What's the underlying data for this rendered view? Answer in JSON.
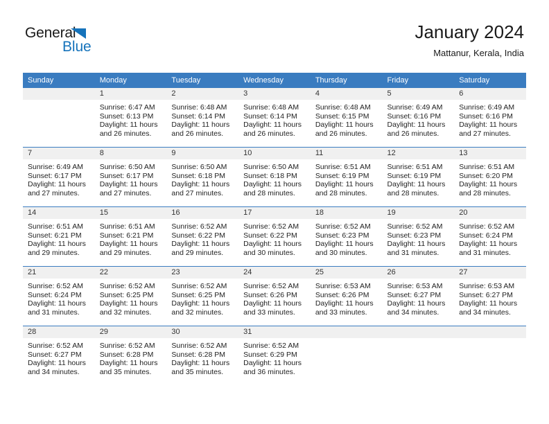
{
  "brand": {
    "name_part1": "General",
    "name_part2": "Blue",
    "triangle_color": "#1573bb"
  },
  "header": {
    "title": "January 2024",
    "subtitle": "Mattanur, Kerala, India",
    "header_bg_color": "#3a7cc0"
  },
  "weekday_headers": [
    "Sunday",
    "Monday",
    "Tuesday",
    "Wednesday",
    "Thursday",
    "Friday",
    "Saturday"
  ],
  "weeks": [
    [
      {
        "day": "",
        "sunrise": "",
        "sunset": "",
        "daylight_line1": "",
        "daylight_line2": ""
      },
      {
        "day": "1",
        "sunrise": "Sunrise: 6:47 AM",
        "sunset": "Sunset: 6:13 PM",
        "daylight_line1": "Daylight: 11 hours",
        "daylight_line2": "and 26 minutes."
      },
      {
        "day": "2",
        "sunrise": "Sunrise: 6:48 AM",
        "sunset": "Sunset: 6:14 PM",
        "daylight_line1": "Daylight: 11 hours",
        "daylight_line2": "and 26 minutes."
      },
      {
        "day": "3",
        "sunrise": "Sunrise: 6:48 AM",
        "sunset": "Sunset: 6:14 PM",
        "daylight_line1": "Daylight: 11 hours",
        "daylight_line2": "and 26 minutes."
      },
      {
        "day": "4",
        "sunrise": "Sunrise: 6:48 AM",
        "sunset": "Sunset: 6:15 PM",
        "daylight_line1": "Daylight: 11 hours",
        "daylight_line2": "and 26 minutes."
      },
      {
        "day": "5",
        "sunrise": "Sunrise: 6:49 AM",
        "sunset": "Sunset: 6:16 PM",
        "daylight_line1": "Daylight: 11 hours",
        "daylight_line2": "and 26 minutes."
      },
      {
        "day": "6",
        "sunrise": "Sunrise: 6:49 AM",
        "sunset": "Sunset: 6:16 PM",
        "daylight_line1": "Daylight: 11 hours",
        "daylight_line2": "and 27 minutes."
      }
    ],
    [
      {
        "day": "7",
        "sunrise": "Sunrise: 6:49 AM",
        "sunset": "Sunset: 6:17 PM",
        "daylight_line1": "Daylight: 11 hours",
        "daylight_line2": "and 27 minutes."
      },
      {
        "day": "8",
        "sunrise": "Sunrise: 6:50 AM",
        "sunset": "Sunset: 6:17 PM",
        "daylight_line1": "Daylight: 11 hours",
        "daylight_line2": "and 27 minutes."
      },
      {
        "day": "9",
        "sunrise": "Sunrise: 6:50 AM",
        "sunset": "Sunset: 6:18 PM",
        "daylight_line1": "Daylight: 11 hours",
        "daylight_line2": "and 27 minutes."
      },
      {
        "day": "10",
        "sunrise": "Sunrise: 6:50 AM",
        "sunset": "Sunset: 6:18 PM",
        "daylight_line1": "Daylight: 11 hours",
        "daylight_line2": "and 28 minutes."
      },
      {
        "day": "11",
        "sunrise": "Sunrise: 6:51 AM",
        "sunset": "Sunset: 6:19 PM",
        "daylight_line1": "Daylight: 11 hours",
        "daylight_line2": "and 28 minutes."
      },
      {
        "day": "12",
        "sunrise": "Sunrise: 6:51 AM",
        "sunset": "Sunset: 6:19 PM",
        "daylight_line1": "Daylight: 11 hours",
        "daylight_line2": "and 28 minutes."
      },
      {
        "day": "13",
        "sunrise": "Sunrise: 6:51 AM",
        "sunset": "Sunset: 6:20 PM",
        "daylight_line1": "Daylight: 11 hours",
        "daylight_line2": "and 28 minutes."
      }
    ],
    [
      {
        "day": "14",
        "sunrise": "Sunrise: 6:51 AM",
        "sunset": "Sunset: 6:21 PM",
        "daylight_line1": "Daylight: 11 hours",
        "daylight_line2": "and 29 minutes."
      },
      {
        "day": "15",
        "sunrise": "Sunrise: 6:51 AM",
        "sunset": "Sunset: 6:21 PM",
        "daylight_line1": "Daylight: 11 hours",
        "daylight_line2": "and 29 minutes."
      },
      {
        "day": "16",
        "sunrise": "Sunrise: 6:52 AM",
        "sunset": "Sunset: 6:22 PM",
        "daylight_line1": "Daylight: 11 hours",
        "daylight_line2": "and 29 minutes."
      },
      {
        "day": "17",
        "sunrise": "Sunrise: 6:52 AM",
        "sunset": "Sunset: 6:22 PM",
        "daylight_line1": "Daylight: 11 hours",
        "daylight_line2": "and 30 minutes."
      },
      {
        "day": "18",
        "sunrise": "Sunrise: 6:52 AM",
        "sunset": "Sunset: 6:23 PM",
        "daylight_line1": "Daylight: 11 hours",
        "daylight_line2": "and 30 minutes."
      },
      {
        "day": "19",
        "sunrise": "Sunrise: 6:52 AM",
        "sunset": "Sunset: 6:23 PM",
        "daylight_line1": "Daylight: 11 hours",
        "daylight_line2": "and 31 minutes."
      },
      {
        "day": "20",
        "sunrise": "Sunrise: 6:52 AM",
        "sunset": "Sunset: 6:24 PM",
        "daylight_line1": "Daylight: 11 hours",
        "daylight_line2": "and 31 minutes."
      }
    ],
    [
      {
        "day": "21",
        "sunrise": "Sunrise: 6:52 AM",
        "sunset": "Sunset: 6:24 PM",
        "daylight_line1": "Daylight: 11 hours",
        "daylight_line2": "and 31 minutes."
      },
      {
        "day": "22",
        "sunrise": "Sunrise: 6:52 AM",
        "sunset": "Sunset: 6:25 PM",
        "daylight_line1": "Daylight: 11 hours",
        "daylight_line2": "and 32 minutes."
      },
      {
        "day": "23",
        "sunrise": "Sunrise: 6:52 AM",
        "sunset": "Sunset: 6:25 PM",
        "daylight_line1": "Daylight: 11 hours",
        "daylight_line2": "and 32 minutes."
      },
      {
        "day": "24",
        "sunrise": "Sunrise: 6:52 AM",
        "sunset": "Sunset: 6:26 PM",
        "daylight_line1": "Daylight: 11 hours",
        "daylight_line2": "and 33 minutes."
      },
      {
        "day": "25",
        "sunrise": "Sunrise: 6:53 AM",
        "sunset": "Sunset: 6:26 PM",
        "daylight_line1": "Daylight: 11 hours",
        "daylight_line2": "and 33 minutes."
      },
      {
        "day": "26",
        "sunrise": "Sunrise: 6:53 AM",
        "sunset": "Sunset: 6:27 PM",
        "daylight_line1": "Daylight: 11 hours",
        "daylight_line2": "and 34 minutes."
      },
      {
        "day": "27",
        "sunrise": "Sunrise: 6:53 AM",
        "sunset": "Sunset: 6:27 PM",
        "daylight_line1": "Daylight: 11 hours",
        "daylight_line2": "and 34 minutes."
      }
    ],
    [
      {
        "day": "28",
        "sunrise": "Sunrise: 6:52 AM",
        "sunset": "Sunset: 6:27 PM",
        "daylight_line1": "Daylight: 11 hours",
        "daylight_line2": "and 34 minutes."
      },
      {
        "day": "29",
        "sunrise": "Sunrise: 6:52 AM",
        "sunset": "Sunset: 6:28 PM",
        "daylight_line1": "Daylight: 11 hours",
        "daylight_line2": "and 35 minutes."
      },
      {
        "day": "30",
        "sunrise": "Sunrise: 6:52 AM",
        "sunset": "Sunset: 6:28 PM",
        "daylight_line1": "Daylight: 11 hours",
        "daylight_line2": "and 35 minutes."
      },
      {
        "day": "31",
        "sunrise": "Sunrise: 6:52 AM",
        "sunset": "Sunset: 6:29 PM",
        "daylight_line1": "Daylight: 11 hours",
        "daylight_line2": "and 36 minutes."
      },
      {
        "day": "",
        "sunrise": "",
        "sunset": "",
        "daylight_line1": "",
        "daylight_line2": ""
      },
      {
        "day": "",
        "sunrise": "",
        "sunset": "",
        "daylight_line1": "",
        "daylight_line2": ""
      },
      {
        "day": "",
        "sunrise": "",
        "sunset": "",
        "daylight_line1": "",
        "daylight_line2": ""
      }
    ]
  ]
}
